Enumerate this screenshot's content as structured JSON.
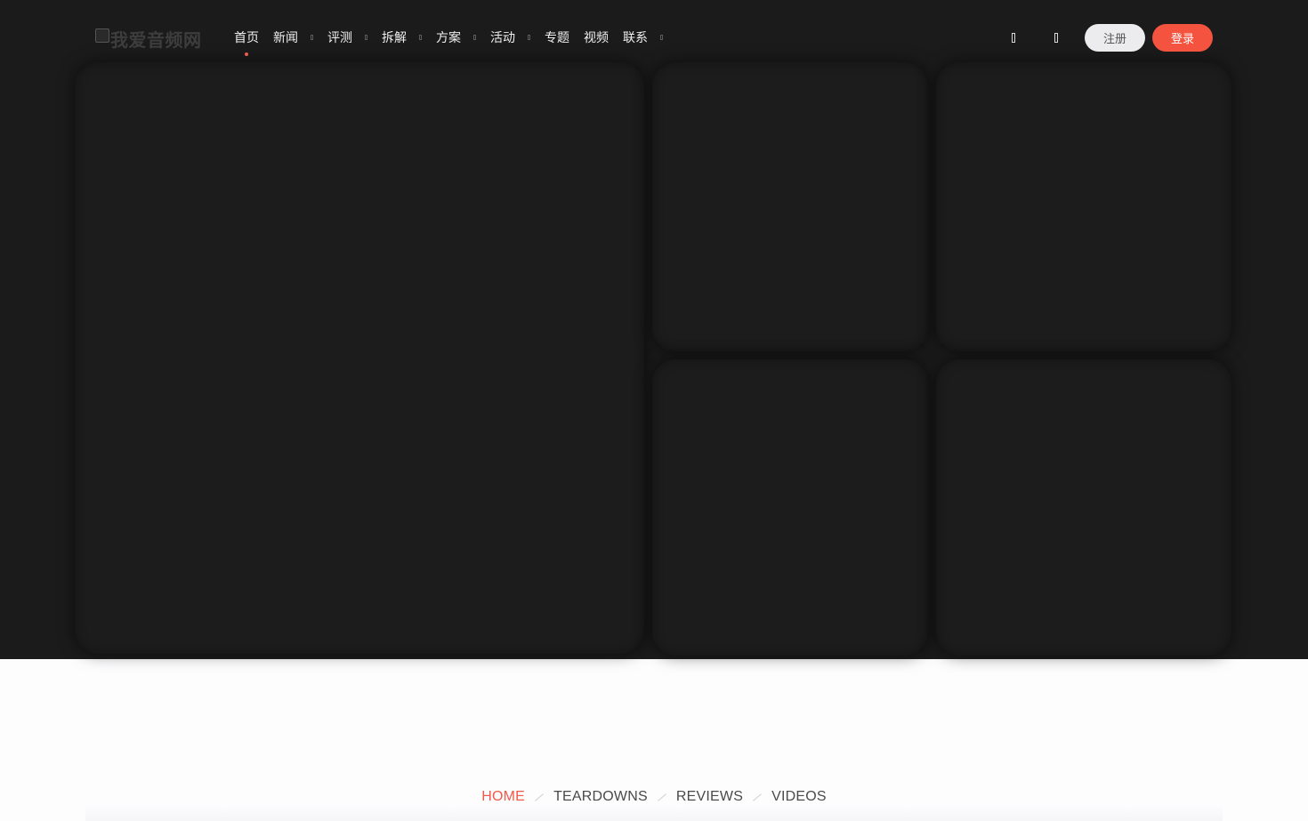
{
  "header": {
    "logo_text": "我爱音频网",
    "nav": [
      {
        "label": "首页",
        "has_dropdown": false,
        "active": true
      },
      {
        "label": "新闻",
        "has_dropdown": true
      },
      {
        "label": "评测",
        "has_dropdown": true
      },
      {
        "label": "拆解",
        "has_dropdown": true
      },
      {
        "label": "方案",
        "has_dropdown": true
      },
      {
        "label": "活动",
        "has_dropdown": true
      },
      {
        "label": "专题",
        "has_dropdown": false
      },
      {
        "label": "视频",
        "has_dropdown": false
      },
      {
        "label": "联系",
        "has_dropdown": true
      }
    ],
    "icons": [
      "search-icon",
      "user-icon"
    ],
    "register_label": "注册",
    "login_label": "登录"
  },
  "tabs": [
    {
      "label": "HOME",
      "active": true
    },
    {
      "label": "TEARDOWNS",
      "active": false
    },
    {
      "label": "REVIEWS",
      "active": false
    },
    {
      "label": "VIDEOS",
      "active": false
    }
  ],
  "colors": {
    "accent": "#f4533f",
    "hero_bg": "#1b1b1c",
    "page_bg": "#fdfdfe"
  }
}
